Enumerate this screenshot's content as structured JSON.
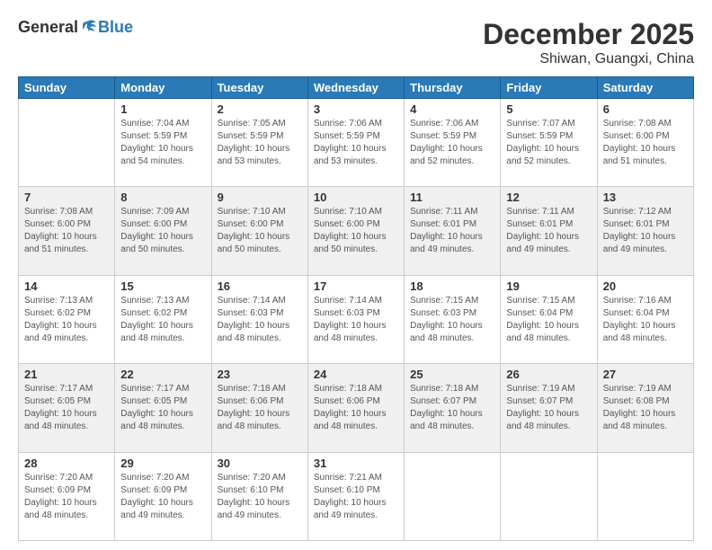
{
  "logo": {
    "general": "General",
    "blue": "Blue"
  },
  "header": {
    "title": "December 2025",
    "subtitle": "Shiwan, Guangxi, China"
  },
  "columns": [
    "Sunday",
    "Monday",
    "Tuesday",
    "Wednesday",
    "Thursday",
    "Friday",
    "Saturday"
  ],
  "weeks": [
    [
      {
        "day": "",
        "info": ""
      },
      {
        "day": "1",
        "info": "Sunrise: 7:04 AM\nSunset: 5:59 PM\nDaylight: 10 hours\nand 54 minutes."
      },
      {
        "day": "2",
        "info": "Sunrise: 7:05 AM\nSunset: 5:59 PM\nDaylight: 10 hours\nand 53 minutes."
      },
      {
        "day": "3",
        "info": "Sunrise: 7:06 AM\nSunset: 5:59 PM\nDaylight: 10 hours\nand 53 minutes."
      },
      {
        "day": "4",
        "info": "Sunrise: 7:06 AM\nSunset: 5:59 PM\nDaylight: 10 hours\nand 52 minutes."
      },
      {
        "day": "5",
        "info": "Sunrise: 7:07 AM\nSunset: 5:59 PM\nDaylight: 10 hours\nand 52 minutes."
      },
      {
        "day": "6",
        "info": "Sunrise: 7:08 AM\nSunset: 6:00 PM\nDaylight: 10 hours\nand 51 minutes."
      }
    ],
    [
      {
        "day": "7",
        "info": "Sunrise: 7:08 AM\nSunset: 6:00 PM\nDaylight: 10 hours\nand 51 minutes."
      },
      {
        "day": "8",
        "info": "Sunrise: 7:09 AM\nSunset: 6:00 PM\nDaylight: 10 hours\nand 50 minutes."
      },
      {
        "day": "9",
        "info": "Sunrise: 7:10 AM\nSunset: 6:00 PM\nDaylight: 10 hours\nand 50 minutes."
      },
      {
        "day": "10",
        "info": "Sunrise: 7:10 AM\nSunset: 6:00 PM\nDaylight: 10 hours\nand 50 minutes."
      },
      {
        "day": "11",
        "info": "Sunrise: 7:11 AM\nSunset: 6:01 PM\nDaylight: 10 hours\nand 49 minutes."
      },
      {
        "day": "12",
        "info": "Sunrise: 7:11 AM\nSunset: 6:01 PM\nDaylight: 10 hours\nand 49 minutes."
      },
      {
        "day": "13",
        "info": "Sunrise: 7:12 AM\nSunset: 6:01 PM\nDaylight: 10 hours\nand 49 minutes."
      }
    ],
    [
      {
        "day": "14",
        "info": "Sunrise: 7:13 AM\nSunset: 6:02 PM\nDaylight: 10 hours\nand 49 minutes."
      },
      {
        "day": "15",
        "info": "Sunrise: 7:13 AM\nSunset: 6:02 PM\nDaylight: 10 hours\nand 48 minutes."
      },
      {
        "day": "16",
        "info": "Sunrise: 7:14 AM\nSunset: 6:03 PM\nDaylight: 10 hours\nand 48 minutes."
      },
      {
        "day": "17",
        "info": "Sunrise: 7:14 AM\nSunset: 6:03 PM\nDaylight: 10 hours\nand 48 minutes."
      },
      {
        "day": "18",
        "info": "Sunrise: 7:15 AM\nSunset: 6:03 PM\nDaylight: 10 hours\nand 48 minutes."
      },
      {
        "day": "19",
        "info": "Sunrise: 7:15 AM\nSunset: 6:04 PM\nDaylight: 10 hours\nand 48 minutes."
      },
      {
        "day": "20",
        "info": "Sunrise: 7:16 AM\nSunset: 6:04 PM\nDaylight: 10 hours\nand 48 minutes."
      }
    ],
    [
      {
        "day": "21",
        "info": "Sunrise: 7:17 AM\nSunset: 6:05 PM\nDaylight: 10 hours\nand 48 minutes."
      },
      {
        "day": "22",
        "info": "Sunrise: 7:17 AM\nSunset: 6:05 PM\nDaylight: 10 hours\nand 48 minutes."
      },
      {
        "day": "23",
        "info": "Sunrise: 7:18 AM\nSunset: 6:06 PM\nDaylight: 10 hours\nand 48 minutes."
      },
      {
        "day": "24",
        "info": "Sunrise: 7:18 AM\nSunset: 6:06 PM\nDaylight: 10 hours\nand 48 minutes."
      },
      {
        "day": "25",
        "info": "Sunrise: 7:18 AM\nSunset: 6:07 PM\nDaylight: 10 hours\nand 48 minutes."
      },
      {
        "day": "26",
        "info": "Sunrise: 7:19 AM\nSunset: 6:07 PM\nDaylight: 10 hours\nand 48 minutes."
      },
      {
        "day": "27",
        "info": "Sunrise: 7:19 AM\nSunset: 6:08 PM\nDaylight: 10 hours\nand 48 minutes."
      }
    ],
    [
      {
        "day": "28",
        "info": "Sunrise: 7:20 AM\nSunset: 6:09 PM\nDaylight: 10 hours\nand 48 minutes."
      },
      {
        "day": "29",
        "info": "Sunrise: 7:20 AM\nSunset: 6:09 PM\nDaylight: 10 hours\nand 49 minutes."
      },
      {
        "day": "30",
        "info": "Sunrise: 7:20 AM\nSunset: 6:10 PM\nDaylight: 10 hours\nand 49 minutes."
      },
      {
        "day": "31",
        "info": "Sunrise: 7:21 AM\nSunset: 6:10 PM\nDaylight: 10 hours\nand 49 minutes."
      },
      {
        "day": "",
        "info": ""
      },
      {
        "day": "",
        "info": ""
      },
      {
        "day": "",
        "info": ""
      }
    ]
  ]
}
